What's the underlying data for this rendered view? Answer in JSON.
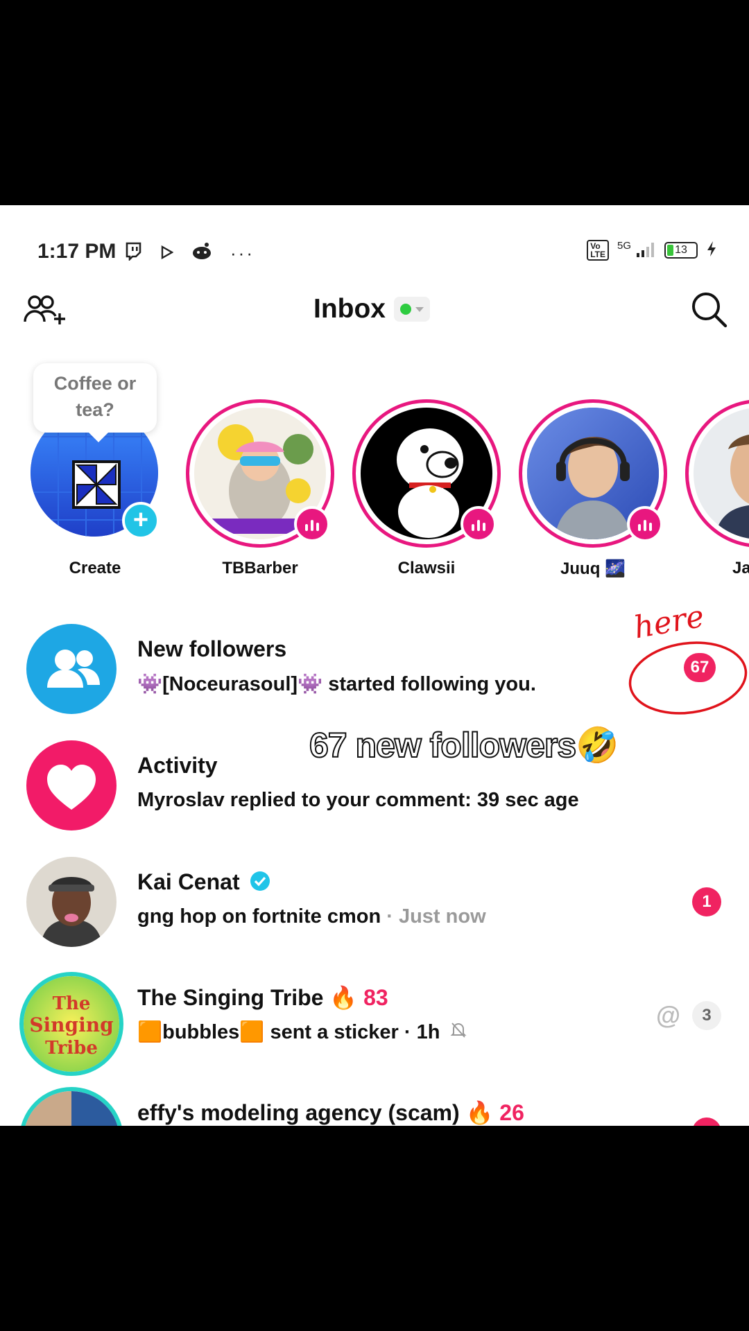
{
  "status_bar": {
    "time": "1:17 PM",
    "network": "5G",
    "battery": "13"
  },
  "header": {
    "title": "Inbox"
  },
  "stories": [
    {
      "name": "Create",
      "bubble": "Coffee or tea?"
    },
    {
      "name": "TBBarber"
    },
    {
      "name": "Clawsii"
    },
    {
      "name": "Juuq 🌌"
    },
    {
      "name": "Jam"
    }
  ],
  "annotation": {
    "handwritten": "here",
    "caption": "67 new followers🤣"
  },
  "inbox": [
    {
      "title": "New followers",
      "subtitle": "👾[Noceurasoul]👾 started following you.",
      "badge": "67"
    },
    {
      "title": "Activity",
      "subtitle": "Myroslav replied to your comment: 39 sec age"
    },
    {
      "title": "Kai Cenat",
      "subtitle": "gng hop on fortnite cmon",
      "time": "· Just now",
      "badge": "1"
    },
    {
      "title": "The Singing Tribe",
      "streak": "🔥",
      "streak_count": "83",
      "subtitle": "🟧bubbles🟧 sent a sticker · 1h",
      "mention": "@",
      "badge": "3"
    },
    {
      "title": "effy's modeling agency (scam)",
      "streak": "🔥",
      "streak_count": "26"
    }
  ],
  "colors": {
    "accent_pink": "#e8177f",
    "badge_red": "#f02361",
    "followers_blue": "#1ea7e4",
    "activity_pink": "#f21b68"
  }
}
